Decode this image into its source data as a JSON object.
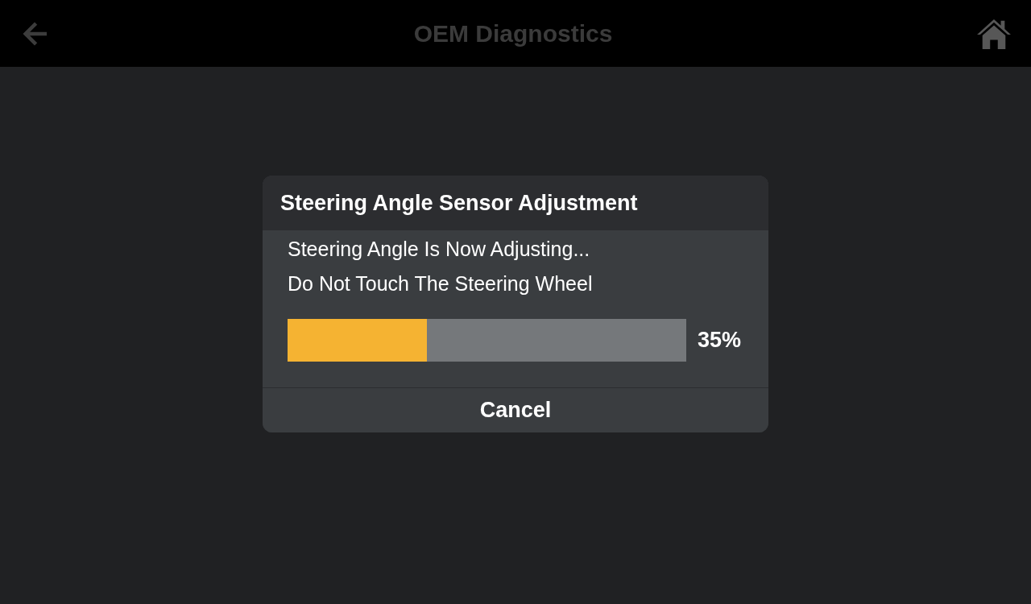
{
  "top_bar": {
    "title": "OEM Diagnostics"
  },
  "dialog": {
    "title": "Steering Angle Sensor Adjustment",
    "messages": [
      "Steering Angle Is Now Adjusting...",
      "Do Not Touch The Steering Wheel"
    ],
    "progress": {
      "level": 0.35,
      "reading": "35%"
    },
    "buttons": [
      "Cancel"
    ]
  }
}
